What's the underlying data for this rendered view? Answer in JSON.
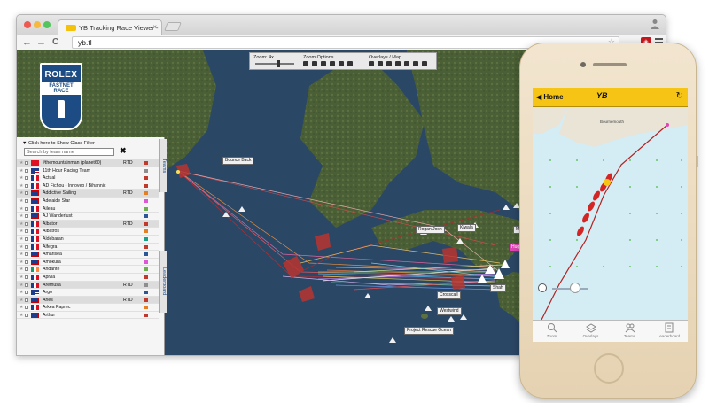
{
  "browser": {
    "tab_title": "YB Tracking Race Viewer -",
    "tab_close": "×",
    "url": "yb.tl",
    "nav": {
      "back": "←",
      "forward": "→",
      "reload": "C"
    },
    "url_star": "☆"
  },
  "logo": {
    "line1": "ROLEX",
    "line2": "FASTNET RACE"
  },
  "map_toolbar": {
    "zoom_label": "Zoom: 4x",
    "zoom_options_label": "Zoom Options",
    "overlays_label": "Overlays / Map"
  },
  "panel": {
    "filter_label": "Click here to Show Class Filter",
    "search_placeholder": "Search by team name",
    "clear": "✖",
    "teams_tab": "Teams",
    "leaderboard_tab": "Leaderboard",
    "rows": [
      {
        "name": "#themountainman (planet60)",
        "status": "RTD",
        "flag": "ch",
        "color": "#c0392b",
        "hl": true
      },
      {
        "name": "11th Hour Racing Team",
        "status": "",
        "flag": "us",
        "color": "#8e8e8e",
        "hl": false
      },
      {
        "name": "Actual",
        "status": "",
        "flag": "fr",
        "color": "#c0392b",
        "hl": false
      },
      {
        "name": "AD Fichou - Innoveo / Bihannic",
        "status": "",
        "flag": "fr",
        "color": "#c0392b",
        "hl": false
      },
      {
        "name": "Addictive Sailing",
        "status": "RTD",
        "flag": "gb",
        "color": "#e67e22",
        "hl": true
      },
      {
        "name": "Adelaide Star",
        "status": "",
        "flag": "gb",
        "color": "#e056d8",
        "hl": false
      },
      {
        "name": "Aileau",
        "status": "",
        "flag": "fr",
        "color": "#6ab04c",
        "hl": false
      },
      {
        "name": "AJ Wanderlust",
        "status": "",
        "flag": "gb",
        "color": "#2b5797",
        "hl": false
      },
      {
        "name": "Albator",
        "status": "RTD",
        "flag": "fr",
        "color": "#c0392b",
        "hl": true
      },
      {
        "name": "Albatros",
        "status": "",
        "flag": "fr",
        "color": "#e67e22",
        "hl": false
      },
      {
        "name": "Aldebaran",
        "status": "",
        "flag": "fr",
        "color": "#16a085",
        "hl": false
      },
      {
        "name": "Alfegra",
        "status": "",
        "flag": "fr",
        "color": "#c0392b",
        "hl": false
      },
      {
        "name": "Amarisea",
        "status": "",
        "flag": "gb",
        "color": "#2b5797",
        "hl": false
      },
      {
        "name": "Amokura",
        "status": "",
        "flag": "gb",
        "color": "#e056d8",
        "hl": false
      },
      {
        "name": "Andante",
        "status": "",
        "flag": "ie",
        "color": "#6ab04c",
        "hl": false
      },
      {
        "name": "Apivia",
        "status": "",
        "flag": "fr",
        "color": "#c0392b",
        "hl": false
      },
      {
        "name": "Arethusa",
        "status": "RTD",
        "flag": "fr",
        "color": "#8e8e8e",
        "hl": true
      },
      {
        "name": "Argo",
        "status": "",
        "flag": "us",
        "color": "#2b5797",
        "hl": false
      },
      {
        "name": "Aries",
        "status": "RTD",
        "flag": "gb",
        "color": "#c0392b",
        "hl": true
      },
      {
        "name": "Arkea Paprec",
        "status": "",
        "flag": "fr",
        "color": "#e67e22",
        "hl": false
      },
      {
        "name": "Arthur",
        "status": "",
        "flag": "gb",
        "color": "#c0392b",
        "hl": false
      }
    ]
  },
  "map_labels": [
    {
      "text": "Bounce Back",
      "pink": false
    },
    {
      "text": "Rogan Josh",
      "pink": false
    },
    {
      "text": "Kiwala",
      "pink": false
    },
    {
      "text": "Mad",
      "pink": false
    },
    {
      "text": "Huge B",
      "pink": true
    },
    {
      "text": "Crosscall",
      "pink": false
    },
    {
      "text": "Westwind",
      "pink": false
    },
    {
      "text": "Shah",
      "pink": false
    },
    {
      "text": "Project Rescue Ocean",
      "pink": false
    }
  ],
  "app": {
    "home_label": "Home",
    "back_icon": "◀",
    "logo_text": "YB",
    "refresh_icon": "↻",
    "place_label": "Bournemouth",
    "tabs": [
      {
        "label": "Zoom"
      },
      {
        "label": "Overlays"
      },
      {
        "label": "Teams"
      },
      {
        "label": "Leaderboard"
      }
    ]
  },
  "colors": {
    "accent": "#f6c415",
    "sea": "#2e4a67",
    "land": "#55653a"
  }
}
